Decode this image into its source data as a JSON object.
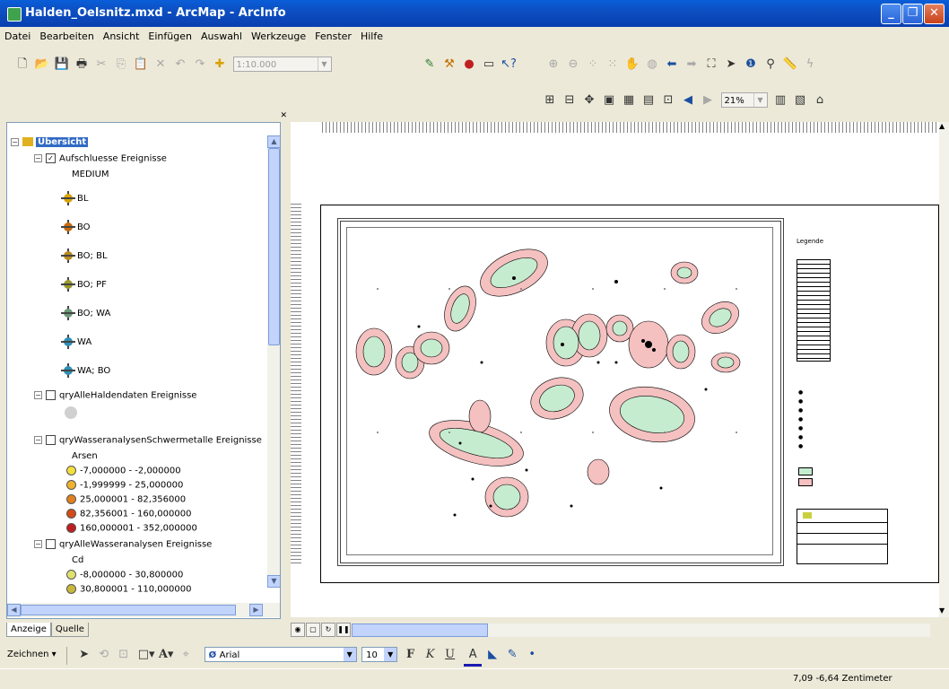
{
  "window": {
    "title": "Halden_Oelsnitz.mxd - ArcMap - ArcInfo"
  },
  "menu": [
    "Datei",
    "Bearbeiten",
    "Ansicht",
    "Einfügen",
    "Auswahl",
    "Werkzeuge",
    "Fenster",
    "Hilfe"
  ],
  "toolbar": {
    "scale_placeholder": "1:10.000",
    "zoom_value": "21%"
  },
  "toc": {
    "root": "Übersicht",
    "layer1": {
      "name": "Aufschluesse Ereignisse",
      "field": "MEDIUM",
      "classes": [
        {
          "label": "BL",
          "color": "#d9a400"
        },
        {
          "label": "BO",
          "color": "#c86a10"
        },
        {
          "label": "BO; BL",
          "color": "#b98a20"
        },
        {
          "label": "BO; PF",
          "color": "#9a9a30"
        },
        {
          "label": "BO; WA",
          "color": "#6f9a7a"
        },
        {
          "label": "WA",
          "color": "#2f8fb4"
        },
        {
          "label": "WA; BO",
          "color": "#2f8fb4"
        }
      ]
    },
    "layer2": {
      "name": "qryAlleHaldendaten Ereignisse"
    },
    "layer3": {
      "name": "qryWasseranalysenSchwermetalle Ereignisse",
      "field": "Arsen",
      "classes": [
        {
          "label": "-7,000000 - -2,000000",
          "color": "#f3df3e"
        },
        {
          "label": "-1,999999 - 25,000000",
          "color": "#f0b12e"
        },
        {
          "label": "25,000001 - 82,356000",
          "color": "#e0801e"
        },
        {
          "label": "82,356001 - 160,000000",
          "color": "#d24b19"
        },
        {
          "label": "160,000001 - 352,000000",
          "color": "#c01e1e"
        }
      ]
    },
    "layer4": {
      "name": "qryAlleWasseranalysen Ereignisse",
      "field": "Cd",
      "classes": [
        {
          "label": "-8,000000 - 30,800000",
          "color": "#e0e070"
        },
        {
          "label": "30,800001 - 110,000000",
          "color": "#c8b83a"
        }
      ]
    }
  },
  "tabs": {
    "display": "Anzeige",
    "source": "Quelle"
  },
  "drawbar": {
    "draw_label": "Zeichnen",
    "font": "Arial",
    "size": "10"
  },
  "legend": {
    "title": "Legende"
  },
  "status": {
    "coords": "7,09 -6,64 Zentimeter"
  }
}
